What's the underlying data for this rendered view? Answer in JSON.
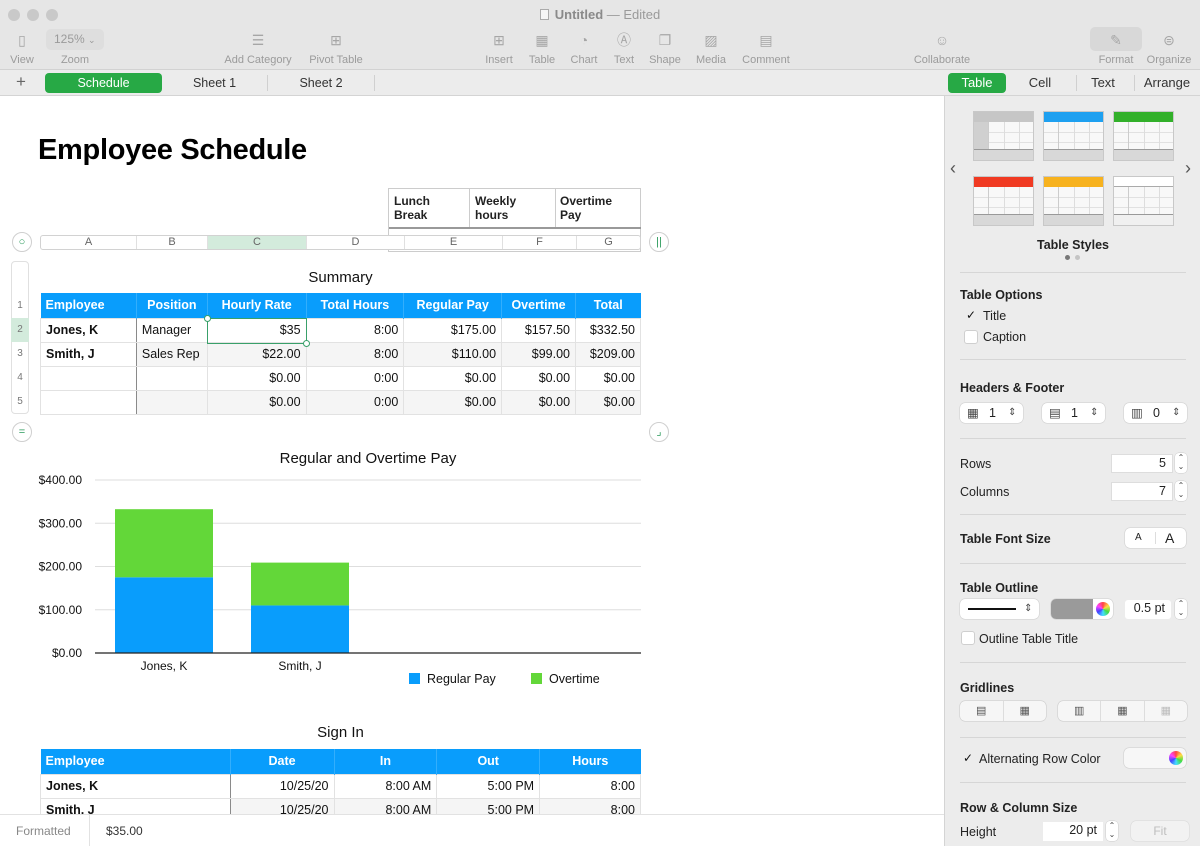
{
  "window": {
    "title": "Untitled",
    "status": "— Edited"
  },
  "toolbar": {
    "zoom_value": "125%",
    "items": [
      {
        "id": "view",
        "label": "View",
        "icon": "sidebar-icon"
      },
      {
        "id": "zoom",
        "label": "Zoom",
        "icon": "zoom-icon"
      },
      {
        "id": "add-category",
        "label": "Add Category",
        "icon": "list-icon"
      },
      {
        "id": "pivot-table",
        "label": "Pivot Table",
        "icon": "pivot-table-icon"
      },
      {
        "id": "insert",
        "label": "Insert",
        "icon": "insert-icon"
      },
      {
        "id": "table",
        "label": "Table",
        "icon": "table-icon"
      },
      {
        "id": "chart",
        "label": "Chart",
        "icon": "chart-icon"
      },
      {
        "id": "text",
        "label": "Text",
        "icon": "text-box-icon"
      },
      {
        "id": "shape",
        "label": "Shape",
        "icon": "shape-icon"
      },
      {
        "id": "media",
        "label": "Media",
        "icon": "media-icon"
      },
      {
        "id": "comment",
        "label": "Comment",
        "icon": "comment-icon"
      },
      {
        "id": "collaborate",
        "label": "Collaborate",
        "icon": "collaborate-icon"
      },
      {
        "id": "format",
        "label": "Format",
        "icon": "paintbrush-icon"
      },
      {
        "id": "organize",
        "label": "Organize",
        "icon": "organize-icon"
      }
    ]
  },
  "sheets": {
    "add_label": "+",
    "tabs": [
      "Schedule",
      "Sheet 1",
      "Sheet 2"
    ],
    "active": "Schedule"
  },
  "panel_tabs": {
    "tabs": [
      "Table",
      "Cell",
      "Text",
      "Arrange"
    ],
    "active": "Table"
  },
  "document": {
    "title": "Employee Schedule",
    "floating_headers": [
      "Lunch\nBreak",
      "Weekly\nhours",
      "Overtime\nPay"
    ],
    "column_letters": [
      "A",
      "B",
      "C",
      "D",
      "E",
      "F",
      "G"
    ],
    "selected_column": "C",
    "row_numbers": [
      "1",
      "2",
      "3",
      "4",
      "5"
    ],
    "selected_row": "2"
  },
  "summary_table": {
    "title": "Summary",
    "headers": [
      "Employee",
      "Position",
      "Hourly Rate",
      "Total Hours",
      "Regular Pay",
      "Overtime",
      "Total"
    ],
    "rows": [
      [
        "Jones, K",
        "Manager",
        "$35",
        "8:00",
        "$175.00",
        "$157.50",
        "$332.50"
      ],
      [
        "Smith, J",
        "Sales Rep",
        "$22.00",
        "8:00",
        "$110.00",
        "$99.00",
        "$209.00"
      ],
      [
        "",
        "",
        "$0.00",
        "0:00",
        "$0.00",
        "$0.00",
        "$0.00"
      ],
      [
        "",
        "",
        "$0.00",
        "0:00",
        "$0.00",
        "$0.00",
        "$0.00"
      ]
    ],
    "header_color": "#099dfc"
  },
  "chart_data": {
    "type": "bar",
    "stacked": true,
    "title": "Regular and Overtime Pay",
    "categories": [
      "Jones, K",
      "Smith, J"
    ],
    "series": [
      {
        "name": "Regular Pay",
        "values": [
          175.0,
          110.0
        ],
        "color": "#099dfc"
      },
      {
        "name": "Overtime",
        "values": [
          157.5,
          99.0
        ],
        "color": "#63d739"
      }
    ],
    "ylim": [
      0,
      400
    ],
    "yticks": [
      0,
      100,
      200,
      300,
      400
    ],
    "ytick_labels": [
      "$0.00",
      "$100.00",
      "$200.00",
      "$300.00",
      "$400.00"
    ],
    "xlabel": "",
    "ylabel": "",
    "grid": true,
    "legend": "bottom-right"
  },
  "signin_table": {
    "title": "Sign In",
    "headers": [
      "Employee",
      "Date",
      "In",
      "Out",
      "Hours"
    ],
    "rows": [
      [
        "Jones, K",
        "10/25/20",
        "8:00 AM",
        "5:00 PM",
        "8:00"
      ],
      [
        "Smith, J",
        "10/25/20",
        "8:00 AM",
        "5:00 PM",
        "8:00"
      ]
    ]
  },
  "status_bar": {
    "label": "Formatted",
    "value": "$35.00"
  },
  "panel": {
    "table_styles_label": "Table Styles",
    "style_colors": [
      "#c6c6c6",
      "#1ea0f0",
      "#32b02a",
      "#f03a22",
      "#f7b21e",
      "#ffffff"
    ],
    "table_options": {
      "title": "Table Options",
      "title_label": "Title",
      "title_checked": true,
      "caption_label": "Caption",
      "caption_checked": false
    },
    "headers_footer": {
      "title": "Headers & Footer",
      "header_rows": "1",
      "header_columns": "1",
      "footer_rows": "0"
    },
    "rows": {
      "label": "Rows",
      "value": "5"
    },
    "columns": {
      "label": "Columns",
      "value": "7"
    },
    "font_size": {
      "label": "Table Font Size",
      "small": "A",
      "large": "A"
    },
    "outline": {
      "title": "Table Outline",
      "width": "0.5 pt",
      "color": "#9a9a9a",
      "outline_title_label": "Outline Table Title",
      "outline_title_checked": false
    },
    "gridlines": {
      "title": "Gridlines"
    },
    "alt_row": {
      "label": "Alternating Row Color",
      "checked": true
    },
    "size": {
      "title": "Row & Column Size",
      "height_label": "Height",
      "height_value": "20 pt",
      "fit_label": "Fit"
    }
  }
}
